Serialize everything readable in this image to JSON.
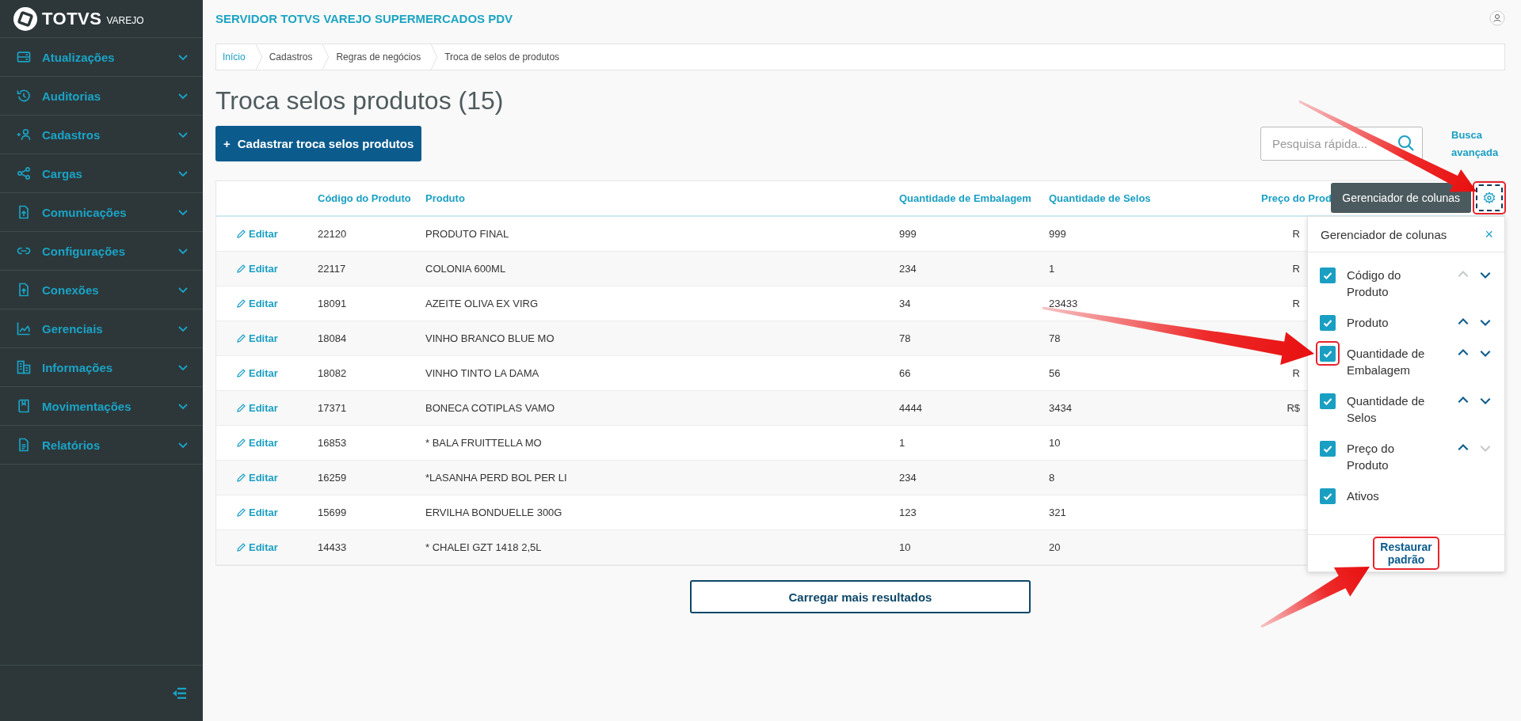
{
  "sidebar": {
    "logo": {
      "brand": "TOTVS",
      "product": "VAREJO"
    },
    "items": [
      {
        "label": "Atualizações",
        "expanded": false
      },
      {
        "label": "Auditorias",
        "expanded": false
      },
      {
        "label": "Cadastros",
        "expanded": false
      },
      {
        "label": "Cargas",
        "expanded": false
      },
      {
        "label": "Comunicações",
        "expanded": false
      },
      {
        "label": "Configurações",
        "expanded": false
      },
      {
        "label": "Conexões",
        "expanded": false
      },
      {
        "label": "Gerenciais",
        "expanded": false
      },
      {
        "label": "Informações",
        "expanded": false
      },
      {
        "label": "Movimentações",
        "expanded": false
      },
      {
        "label": "Relatórios",
        "expanded": false
      }
    ]
  },
  "header": {
    "title": "SERVIDOR TOTVS VAREJO SUPERMERCADOS PDV"
  },
  "breadcrumb": [
    {
      "label": "Início",
      "kind": "link"
    },
    {
      "label": "Cadastros",
      "kind": "text"
    },
    {
      "label": "Regras de negócios",
      "kind": "text"
    },
    {
      "label": "Troca de selos de produtos",
      "kind": "text"
    }
  ],
  "page_title": "Troca selos produtos (15)",
  "add_button": {
    "icon": "+",
    "label": "Cadastrar troca selos produtos"
  },
  "search": {
    "placeholder": "Pesquisa rápida..."
  },
  "advanced_search": "Busca avançada",
  "table": {
    "columns": [
      "Código do Produto",
      "Produto",
      "Quantidade de Embalagem",
      "Quantidade de Selos",
      "Preço do Prod"
    ],
    "settings_button": {
      "highlighted": true
    },
    "tooltip": "Gerenciador de colunas",
    "rows": [
      {
        "action": "Editar",
        "code": "22120",
        "product": "PRODUTO FINAL",
        "package_qty": "999",
        "seal_qty": "999",
        "price": "R"
      },
      {
        "action": "Editar",
        "code": "22117",
        "product": "COLONIA 600ML",
        "package_qty": "234",
        "seal_qty": "1",
        "price": "R"
      },
      {
        "action": "Editar",
        "code": "18091",
        "product": "AZEITE OLIVA EX VIRG",
        "package_qty": "34",
        "seal_qty": "23433",
        "price": "R"
      },
      {
        "action": "Editar",
        "code": "18084",
        "product": "VINHO BRANCO BLUE MO",
        "package_qty": "78",
        "seal_qty": "78"
      },
      {
        "action": "Editar",
        "code": "18082",
        "product": "VINHO TINTO LA DAMA",
        "package_qty": "66",
        "seal_qty": "56",
        "price": "R"
      },
      {
        "action": "Editar",
        "code": "17371",
        "product": "BONECA COTIPLAS VAMO",
        "package_qty": "4444",
        "seal_qty": "3434",
        "price": "R$"
      },
      {
        "action": "Editar",
        "code": "16853",
        "product": "* BALA FRUITTELLA MO",
        "package_qty": "1",
        "seal_qty": "10"
      },
      {
        "action": "Editar",
        "code": "16259",
        "product": "*LASANHA PERD BOL PER LI",
        "package_qty": "234",
        "seal_qty": "8"
      },
      {
        "action": "Editar",
        "code": "15699",
        "product": "ERVILHA BONDUELLE 300G",
        "package_qty": "123",
        "seal_qty": "321"
      },
      {
        "action": "Editar",
        "code": "14433",
        "product": "* CHALEI GZT 1418 2,5L",
        "package_qty": "10",
        "seal_qty": "20"
      }
    ]
  },
  "column_manager": {
    "title": "Gerenciador de colunas",
    "close": "×",
    "items": [
      {
        "label": "Código do Produto",
        "checked": true,
        "kind": "sortable",
        "up_enabled": false,
        "down_enabled": true,
        "highlighted": false
      },
      {
        "label": "Produto",
        "checked": true,
        "kind": "sortable",
        "up_enabled": true,
        "down_enabled": true,
        "highlighted": false
      },
      {
        "label": "Quantidade de Embalagem",
        "checked": true,
        "kind": "sortable",
        "up_enabled": true,
        "down_enabled": true,
        "highlighted": true
      },
      {
        "label": "Quantidade de Selos",
        "checked": true,
        "kind": "sortable",
        "up_enabled": true,
        "down_enabled": true,
        "highlighted": false
      },
      {
        "label": "Preço do Produto",
        "checked": true,
        "kind": "sortable",
        "up_enabled": true,
        "down_enabled": false,
        "highlighted": false
      },
      {
        "label": "Ativos",
        "checked": true,
        "kind": "fixed",
        "highlighted": false
      }
    ],
    "restore_button": {
      "label": "Restaurar padrão",
      "highlighted": true
    }
  },
  "load_more": "Carregar mais resultados"
}
